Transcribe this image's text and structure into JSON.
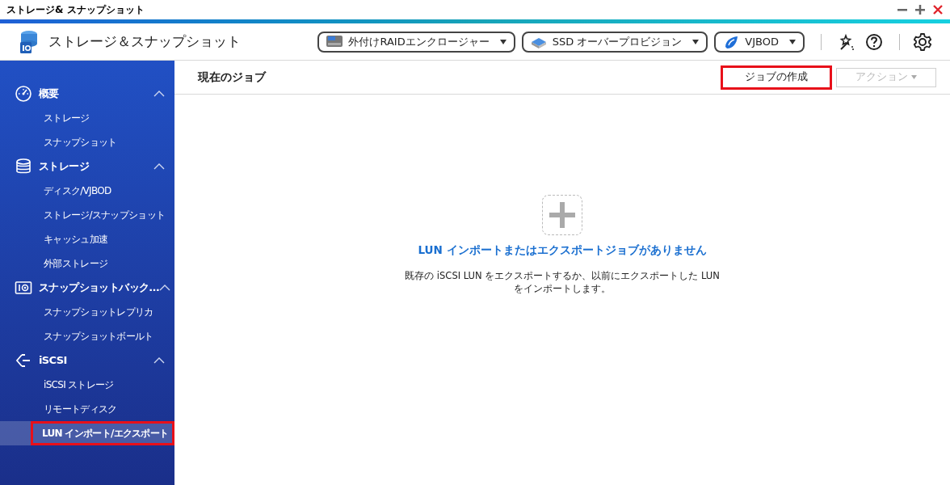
{
  "window": {
    "title": "ストレージ& スナップショット"
  },
  "app": {
    "title": "ストレージ＆スナップショット"
  },
  "toolbar": {
    "dropdowns": [
      {
        "kind": "raid",
        "label": "外付けRAIDエンクロージャー"
      },
      {
        "kind": "ssd",
        "label": "SSD オーバープロビジョン"
      },
      {
        "kind": "vjbod",
        "label": "VJBOD"
      }
    ]
  },
  "sidebar": {
    "sections": [
      {
        "kind": "gauge",
        "label": "概要",
        "expanded": true,
        "items": [
          {
            "label": "ストレージ",
            "selected": false,
            "highlighted": false
          },
          {
            "label": "スナップショット",
            "selected": false,
            "highlighted": false
          }
        ]
      },
      {
        "kind": "database",
        "label": "ストレージ",
        "expanded": true,
        "items": [
          {
            "label": "ディスク/VJBOD",
            "selected": false,
            "highlighted": false
          },
          {
            "label": "ストレージ/スナップショット",
            "selected": false,
            "highlighted": false
          },
          {
            "label": "キャッシュ加速",
            "selected": false,
            "highlighted": false
          },
          {
            "label": "外部ストレージ",
            "selected": false,
            "highlighted": false
          }
        ]
      },
      {
        "kind": "camera",
        "label": "スナップショットバック…",
        "expanded": true,
        "items": [
          {
            "label": "スナップショットレプリカ",
            "selected": false,
            "highlighted": false
          },
          {
            "label": "スナップショットボールト",
            "selected": false,
            "highlighted": false
          }
        ]
      },
      {
        "kind": "iscsi",
        "label": "iSCSI",
        "expanded": true,
        "items": [
          {
            "label": "iSCSI ストレージ",
            "selected": false,
            "highlighted": false
          },
          {
            "label": "リモートディスク",
            "selected": false,
            "highlighted": false
          },
          {
            "label": "LUN インポート/エクスポート",
            "selected": true,
            "highlighted": true
          }
        ]
      }
    ]
  },
  "content": {
    "title": "現在のジョブ",
    "buttons": [
      {
        "label": "ジョブの作成",
        "disabled": false,
        "highlighted": true
      },
      {
        "label": "アクション",
        "disabled": true,
        "highlighted": false
      }
    ],
    "empty_title": "LUN インポートまたはエクスポートジョブがありません",
    "empty_text": "既存の iSCSI LUN をエクスポートするか、以前にエクスポートした LUN をインポートします。"
  }
}
